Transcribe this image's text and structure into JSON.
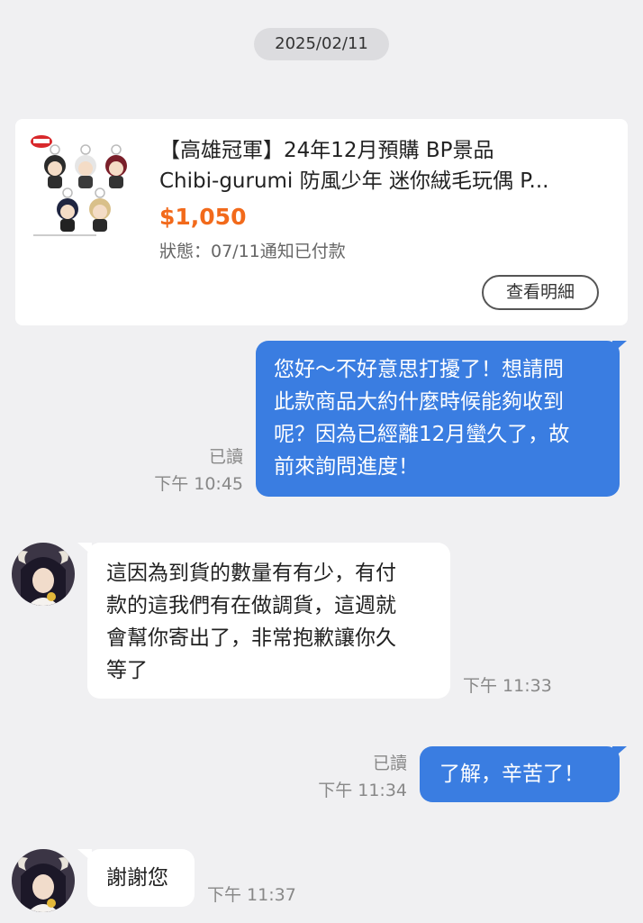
{
  "date_separator": "2025/02/11",
  "order_card": {
    "title_line1": "【高雄冠軍】24年12月預購 BP景品",
    "title_line2": "Chibi-gurumi 防風少年 迷你絨毛玩偶 P...",
    "price": "$1,050",
    "status": "狀態：07/11通知已付款",
    "detail_button": "查看明細"
  },
  "messages": {
    "m1": {
      "lines": [
        "您好～不好意思打擾了！想請問",
        "此款商品大約什麼時候能夠收到",
        "呢？因為已經離12月蠻久了，故",
        "前來詢問進度！"
      ],
      "read": "已讀",
      "time": "下午 10:45"
    },
    "m2": {
      "lines": [
        "這因為到貨的數量有有少，有付",
        "款的這我們有在做調貨，這週就",
        "會幫你寄出了，非常抱歉讓你久",
        "等了"
      ],
      "time": "下午 11:33"
    },
    "m3": {
      "text": "了解，辛苦了！",
      "read": "已讀",
      "time": "下午 11:34"
    },
    "m4": {
      "text": "謝謝您",
      "time": "下午 11:37"
    }
  },
  "colors": {
    "outgoing_bubble": "#3a7de1",
    "price": "#f26a1b",
    "background": "#f0f0f2"
  }
}
